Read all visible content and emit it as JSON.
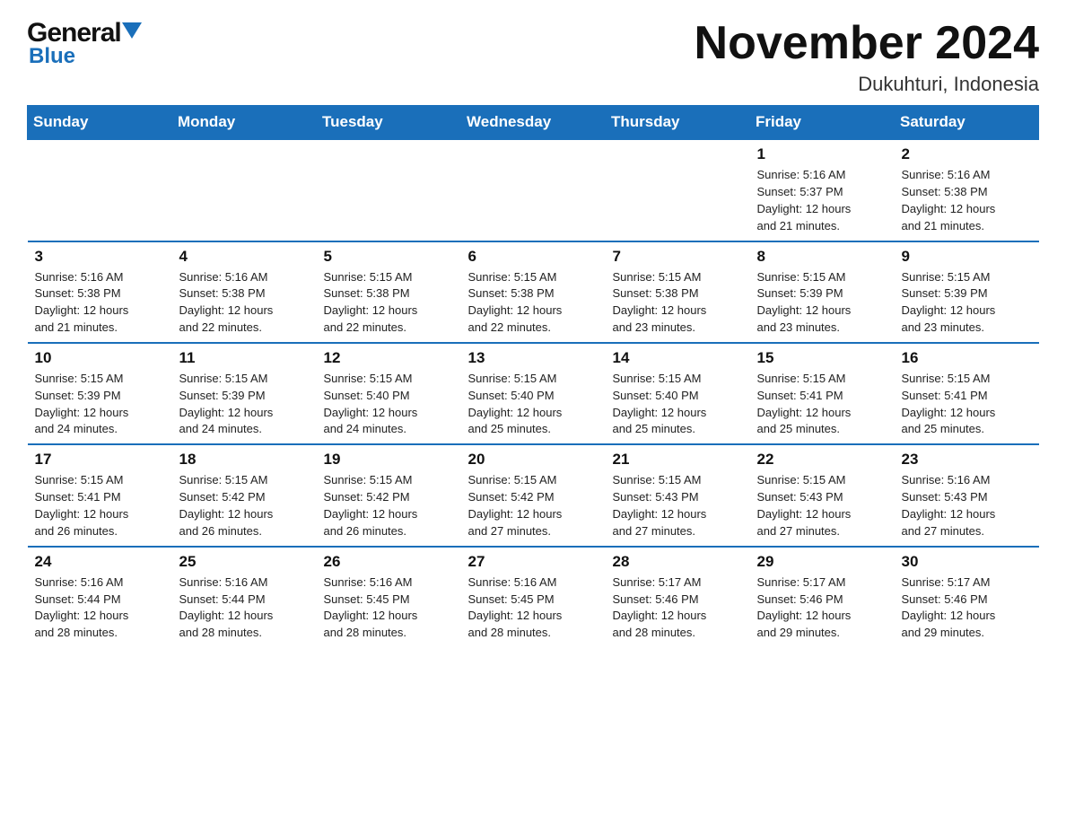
{
  "header": {
    "logo_general": "General",
    "logo_blue": "Blue",
    "month_title": "November 2024",
    "subtitle": "Dukuhturi, Indonesia"
  },
  "weekdays": [
    "Sunday",
    "Monday",
    "Tuesday",
    "Wednesday",
    "Thursday",
    "Friday",
    "Saturday"
  ],
  "weeks": [
    [
      {
        "day": "",
        "info": ""
      },
      {
        "day": "",
        "info": ""
      },
      {
        "day": "",
        "info": ""
      },
      {
        "day": "",
        "info": ""
      },
      {
        "day": "",
        "info": ""
      },
      {
        "day": "1",
        "info": "Sunrise: 5:16 AM\nSunset: 5:37 PM\nDaylight: 12 hours\nand 21 minutes."
      },
      {
        "day": "2",
        "info": "Sunrise: 5:16 AM\nSunset: 5:38 PM\nDaylight: 12 hours\nand 21 minutes."
      }
    ],
    [
      {
        "day": "3",
        "info": "Sunrise: 5:16 AM\nSunset: 5:38 PM\nDaylight: 12 hours\nand 21 minutes."
      },
      {
        "day": "4",
        "info": "Sunrise: 5:16 AM\nSunset: 5:38 PM\nDaylight: 12 hours\nand 22 minutes."
      },
      {
        "day": "5",
        "info": "Sunrise: 5:15 AM\nSunset: 5:38 PM\nDaylight: 12 hours\nand 22 minutes."
      },
      {
        "day": "6",
        "info": "Sunrise: 5:15 AM\nSunset: 5:38 PM\nDaylight: 12 hours\nand 22 minutes."
      },
      {
        "day": "7",
        "info": "Sunrise: 5:15 AM\nSunset: 5:38 PM\nDaylight: 12 hours\nand 23 minutes."
      },
      {
        "day": "8",
        "info": "Sunrise: 5:15 AM\nSunset: 5:39 PM\nDaylight: 12 hours\nand 23 minutes."
      },
      {
        "day": "9",
        "info": "Sunrise: 5:15 AM\nSunset: 5:39 PM\nDaylight: 12 hours\nand 23 minutes."
      }
    ],
    [
      {
        "day": "10",
        "info": "Sunrise: 5:15 AM\nSunset: 5:39 PM\nDaylight: 12 hours\nand 24 minutes."
      },
      {
        "day": "11",
        "info": "Sunrise: 5:15 AM\nSunset: 5:39 PM\nDaylight: 12 hours\nand 24 minutes."
      },
      {
        "day": "12",
        "info": "Sunrise: 5:15 AM\nSunset: 5:40 PM\nDaylight: 12 hours\nand 24 minutes."
      },
      {
        "day": "13",
        "info": "Sunrise: 5:15 AM\nSunset: 5:40 PM\nDaylight: 12 hours\nand 25 minutes."
      },
      {
        "day": "14",
        "info": "Sunrise: 5:15 AM\nSunset: 5:40 PM\nDaylight: 12 hours\nand 25 minutes."
      },
      {
        "day": "15",
        "info": "Sunrise: 5:15 AM\nSunset: 5:41 PM\nDaylight: 12 hours\nand 25 minutes."
      },
      {
        "day": "16",
        "info": "Sunrise: 5:15 AM\nSunset: 5:41 PM\nDaylight: 12 hours\nand 25 minutes."
      }
    ],
    [
      {
        "day": "17",
        "info": "Sunrise: 5:15 AM\nSunset: 5:41 PM\nDaylight: 12 hours\nand 26 minutes."
      },
      {
        "day": "18",
        "info": "Sunrise: 5:15 AM\nSunset: 5:42 PM\nDaylight: 12 hours\nand 26 minutes."
      },
      {
        "day": "19",
        "info": "Sunrise: 5:15 AM\nSunset: 5:42 PM\nDaylight: 12 hours\nand 26 minutes."
      },
      {
        "day": "20",
        "info": "Sunrise: 5:15 AM\nSunset: 5:42 PM\nDaylight: 12 hours\nand 27 minutes."
      },
      {
        "day": "21",
        "info": "Sunrise: 5:15 AM\nSunset: 5:43 PM\nDaylight: 12 hours\nand 27 minutes."
      },
      {
        "day": "22",
        "info": "Sunrise: 5:15 AM\nSunset: 5:43 PM\nDaylight: 12 hours\nand 27 minutes."
      },
      {
        "day": "23",
        "info": "Sunrise: 5:16 AM\nSunset: 5:43 PM\nDaylight: 12 hours\nand 27 minutes."
      }
    ],
    [
      {
        "day": "24",
        "info": "Sunrise: 5:16 AM\nSunset: 5:44 PM\nDaylight: 12 hours\nand 28 minutes."
      },
      {
        "day": "25",
        "info": "Sunrise: 5:16 AM\nSunset: 5:44 PM\nDaylight: 12 hours\nand 28 minutes."
      },
      {
        "day": "26",
        "info": "Sunrise: 5:16 AM\nSunset: 5:45 PM\nDaylight: 12 hours\nand 28 minutes."
      },
      {
        "day": "27",
        "info": "Sunrise: 5:16 AM\nSunset: 5:45 PM\nDaylight: 12 hours\nand 28 minutes."
      },
      {
        "day": "28",
        "info": "Sunrise: 5:17 AM\nSunset: 5:46 PM\nDaylight: 12 hours\nand 28 minutes."
      },
      {
        "day": "29",
        "info": "Sunrise: 5:17 AM\nSunset: 5:46 PM\nDaylight: 12 hours\nand 29 minutes."
      },
      {
        "day": "30",
        "info": "Sunrise: 5:17 AM\nSunset: 5:46 PM\nDaylight: 12 hours\nand 29 minutes."
      }
    ]
  ]
}
